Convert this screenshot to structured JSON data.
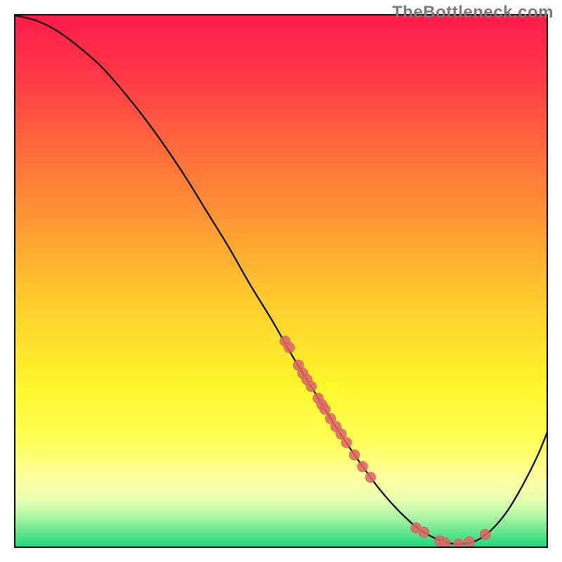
{
  "watermark": "TheBottleneck.com",
  "chart_data": {
    "type": "line",
    "title": "",
    "xlabel": "",
    "ylabel": "",
    "xlim": [
      0,
      100
    ],
    "ylim": [
      0,
      100
    ],
    "curve": [
      {
        "x": 0,
        "y": 100
      },
      {
        "x": 4,
        "y": 99
      },
      {
        "x": 8,
        "y": 97
      },
      {
        "x": 12,
        "y": 94
      },
      {
        "x": 16,
        "y": 90.5
      },
      {
        "x": 20,
        "y": 86
      },
      {
        "x": 24,
        "y": 81
      },
      {
        "x": 28,
        "y": 75.5
      },
      {
        "x": 32,
        "y": 69.5
      },
      {
        "x": 36,
        "y": 63
      },
      {
        "x": 40,
        "y": 56.5
      },
      {
        "x": 44,
        "y": 49.5
      },
      {
        "x": 48,
        "y": 43
      },
      {
        "x": 52,
        "y": 36
      },
      {
        "x": 56,
        "y": 29.5
      },
      {
        "x": 60,
        "y": 23
      },
      {
        "x": 64,
        "y": 17
      },
      {
        "x": 68,
        "y": 11.5
      },
      {
        "x": 72,
        "y": 7
      },
      {
        "x": 76,
        "y": 3.5
      },
      {
        "x": 80,
        "y": 1.5
      },
      {
        "x": 83,
        "y": 1
      },
      {
        "x": 86,
        "y": 1.5
      },
      {
        "x": 89,
        "y": 3.5
      },
      {
        "x": 92,
        "y": 7
      },
      {
        "x": 95,
        "y": 12
      },
      {
        "x": 98,
        "y": 18
      },
      {
        "x": 100,
        "y": 23
      }
    ],
    "scatter": [
      {
        "x": 50.5,
        "y": 39
      },
      {
        "x": 51.3,
        "y": 37.8
      },
      {
        "x": 53.0,
        "y": 34.5
      },
      {
        "x": 53.8,
        "y": 33.0
      },
      {
        "x": 54.6,
        "y": 31.8
      },
      {
        "x": 55.4,
        "y": 30.5
      },
      {
        "x": 56.7,
        "y": 28.3
      },
      {
        "x": 57.4,
        "y": 27.1
      },
      {
        "x": 58.0,
        "y": 26.2
      },
      {
        "x": 59.0,
        "y": 24.5
      },
      {
        "x": 60.0,
        "y": 23.0
      },
      {
        "x": 61.0,
        "y": 21.6
      },
      {
        "x": 62.0,
        "y": 20.0
      },
      {
        "x": 63.5,
        "y": 17.7
      },
      {
        "x": 65.0,
        "y": 15.5
      },
      {
        "x": 66.5,
        "y": 13.5
      },
      {
        "x": 75.0,
        "y": 4.0
      },
      {
        "x": 76.5,
        "y": 3.2
      },
      {
        "x": 79.5,
        "y": 1.6
      },
      {
        "x": 80.5,
        "y": 1.2
      },
      {
        "x": 83.0,
        "y": 1.0
      },
      {
        "x": 85.0,
        "y": 1.4
      },
      {
        "x": 88.0,
        "y": 2.8
      }
    ],
    "gradient_stops": [
      {
        "offset": 0.0,
        "color": "#ff1c4a"
      },
      {
        "offset": 0.12,
        "color": "#ff3a47"
      },
      {
        "offset": 0.25,
        "color": "#ff6a3c"
      },
      {
        "offset": 0.4,
        "color": "#ff9c33"
      },
      {
        "offset": 0.55,
        "color": "#ffd02c"
      },
      {
        "offset": 0.7,
        "color": "#fff72c"
      },
      {
        "offset": 0.8,
        "color": "#ffff55"
      },
      {
        "offset": 0.87,
        "color": "#ffff9e"
      },
      {
        "offset": 0.91,
        "color": "#e9ffb0"
      },
      {
        "offset": 0.94,
        "color": "#b7f7a8"
      },
      {
        "offset": 0.97,
        "color": "#6be88e"
      },
      {
        "offset": 1.0,
        "color": "#1fd87a"
      }
    ],
    "colors": {
      "curve": "#000000",
      "point_fill": "#e06666",
      "point_stroke": "#cc5555",
      "border": "#000000"
    }
  }
}
